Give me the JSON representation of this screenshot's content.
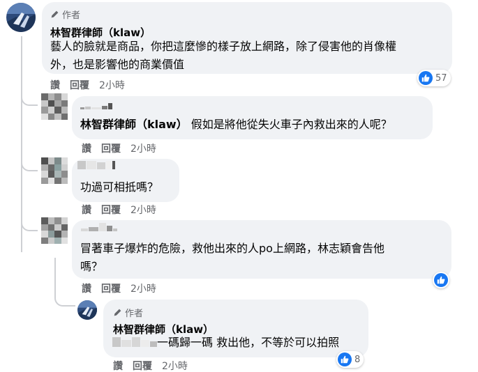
{
  "comment1": {
    "author_tag": "作者",
    "name": "林智群律師（klaw）",
    "lines": [
      "藝人的臉就是商品，你把這麼慘的樣子放上網路，除了侵害他的肖像權",
      "外，也是影響他的商業價值"
    ],
    "actions": {
      "like": "讚",
      "reply": "回覆",
      "time": "2小時"
    },
    "reaction_count": "57",
    "reaction_icon": "like-icon"
  },
  "reply1": {
    "mention": "林智群律師（klaw）",
    "text": " 假如是將他從失火車子內救出來的人呢？",
    "actions": {
      "like": "讚",
      "reply": "回覆",
      "time": "2小時"
    }
  },
  "reply2": {
    "text": "功過可相抵嗎？",
    "actions": {
      "like": "讚",
      "reply": "回覆",
      "time": "2小時"
    }
  },
  "reply3": {
    "lines": [
      "冒著車子爆炸的危險，救他出來的人po上網路，林志穎會告他",
      "嗎？"
    ],
    "actions": {
      "like": "讚",
      "reply": "回覆",
      "time": "2小時"
    },
    "reaction_icon": "like-icon"
  },
  "reply4": {
    "author_tag": "作者",
    "name": "林智群律師（klaw）",
    "text": "一碼歸一碼 救出他，不等於可以拍照",
    "actions": {
      "like": "讚",
      "reply": "回覆",
      "time": "2小時"
    },
    "reaction_count": "8",
    "reaction_icon": "like-icon"
  },
  "colors": {
    "bubble": "#f0f2f5",
    "secondary_text": "#65676b",
    "like_blue": "#1877f2",
    "thread_line": "#ced0d4"
  }
}
